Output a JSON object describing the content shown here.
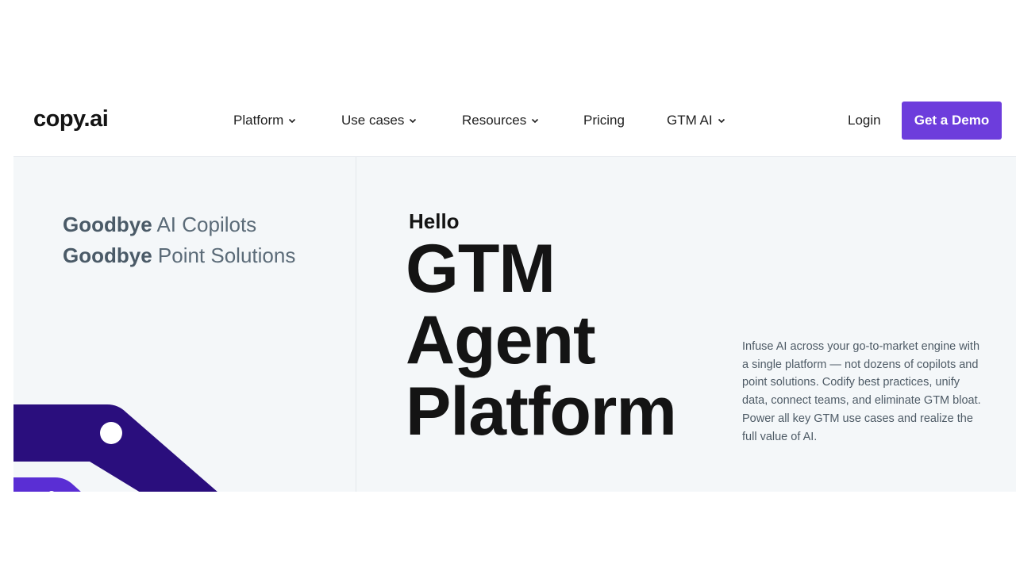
{
  "brand": {
    "logo": "copy.ai",
    "accent": "#6d3ddc",
    "shape_primary": "#2a0e7d",
    "shape_secondary": "#5a2ed4"
  },
  "nav": {
    "items": [
      {
        "label": "Platform",
        "dropdown": true
      },
      {
        "label": "Use cases",
        "dropdown": true
      },
      {
        "label": "Resources",
        "dropdown": true
      },
      {
        "label": "Pricing",
        "dropdown": false
      },
      {
        "label": "GTM AI",
        "dropdown": true
      }
    ],
    "login": "Login",
    "cta": "Get a Demo"
  },
  "hero": {
    "goodbye": [
      {
        "strong": "Goodbye",
        "rest": " AI Copilots"
      },
      {
        "strong": "Goodbye",
        "rest": " Point Solutions"
      }
    ],
    "hello": "Hello",
    "headline": [
      "GTM",
      "Agent",
      "Platform"
    ],
    "description": "Infuse AI across your go-to-market engine with a single platform — not dozens of copilots and point solutions. Codify best practices, unify data, connect teams, and eliminate GTM bloat. Power all key GTM use cases and realize the full value of AI."
  },
  "icons": {
    "chevron": "chevron-down-icon"
  }
}
